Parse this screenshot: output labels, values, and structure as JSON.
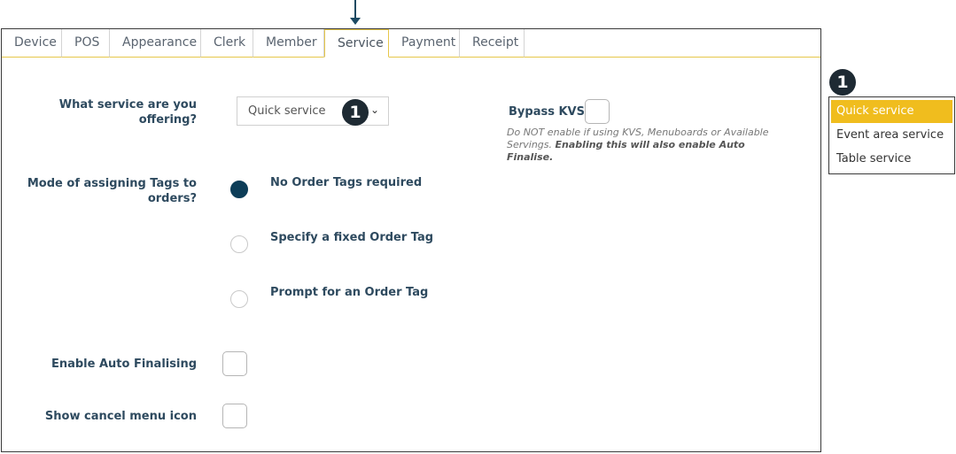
{
  "tabs": [
    "Device",
    "POS",
    "Appearance",
    "Clerk",
    "Member",
    "Service",
    "Payment",
    "Receipt"
  ],
  "active_tab": "Service",
  "service": {
    "label_line1": "What service are you",
    "label_line2": "offering?",
    "selected": "Quick service",
    "badge": "1"
  },
  "bypass_kvs": {
    "label": "Bypass KVS",
    "hint_normal": "Do NOT enable if using KVS, Menuboards or Available Servings.",
    "hint_bold": "Enabling this will also enable Auto Finalise."
  },
  "tags": {
    "label_line1": "Mode of assigning Tags to",
    "label_line2": "orders?",
    "options": [
      "No Order Tags required",
      "Specify a fixed Order Tag",
      "Prompt for an Order Tag"
    ],
    "selected_index": 0
  },
  "auto_finalising": {
    "label": "Enable Auto Finalising"
  },
  "cancel_icon": {
    "label": "Show cancel menu icon"
  },
  "dropdown": {
    "badge": "1",
    "options": [
      "Quick service",
      "Event area service",
      "Table service"
    ],
    "selected_index": 0
  },
  "colors": {
    "accent": "#f0bd1e",
    "radio_selected": "#0d3d58",
    "badge": "#1e2a33",
    "label": "#2e4a5f"
  }
}
